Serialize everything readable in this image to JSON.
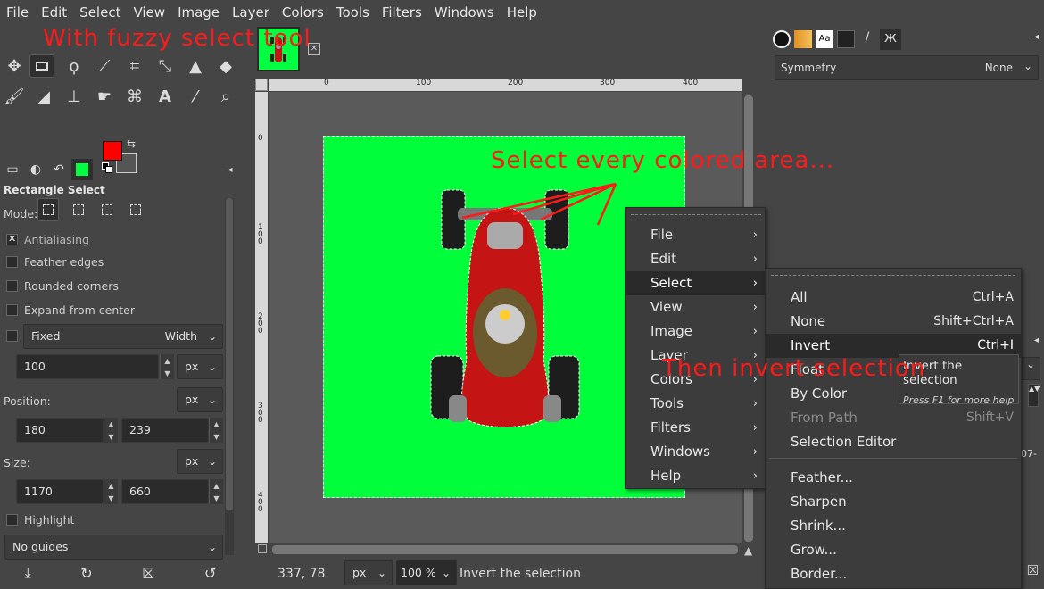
{
  "menubar": [
    "File",
    "Edit",
    "Select",
    "View",
    "Image",
    "Layer",
    "Colors",
    "Tools",
    "Filters",
    "Windows",
    "Help"
  ],
  "toolbox": {
    "tool_icons": [
      "move-tool-icon",
      "rectangle-select-icon",
      "lasso-icon",
      "fuzzy-select-icon",
      "crop-icon",
      "transform-icon",
      "warp-icon",
      "bucket-fill-icon",
      "paintbrush-icon",
      "eraser-icon",
      "clone-icon",
      "smudge-icon",
      "paths-icon",
      "text-icon",
      "color-picker-icon",
      "zoom-icon"
    ],
    "fg_color": "#ff0000",
    "bg_color": "#555555"
  },
  "tool_options": {
    "title": "Rectangle Select",
    "mode_label": "Mode:",
    "antialiasing": "Antialiasing",
    "feather_edges": "Feather edges",
    "rounded_corners": "Rounded corners",
    "expand_from_center": "Expand from center",
    "fixed": "Fixed",
    "fixed_mode": "Width",
    "fixed_value": "100",
    "fixed_unit": "px",
    "position_label": "Position:",
    "position_unit": "px",
    "pos_x": "180",
    "pos_y": "239",
    "size_label": "Size:",
    "size_unit": "px",
    "size_w": "1170",
    "size_h": "660",
    "highlight": "Highlight",
    "guides": "No guides"
  },
  "rulers": {
    "top": [
      "0",
      "100",
      "200",
      "300",
      "400"
    ],
    "left": [
      "0",
      "1 0 0",
      "2 0 0",
      "3 0 0",
      "4 0 0"
    ]
  },
  "statusbar": {
    "coords": "337, 78",
    "unit": "px",
    "zoom": "100 %",
    "message": "Invert the selection"
  },
  "right_dock": {
    "symmetry_label": "Symmetry",
    "symmetry_value": "None"
  },
  "context_menu": {
    "items": [
      "File",
      "Edit",
      "Select",
      "View",
      "Image",
      "Layer",
      "Colors",
      "Tools",
      "Filters",
      "Windows",
      "Help"
    ],
    "selected": "Select"
  },
  "select_submenu": {
    "items": [
      {
        "label": "All",
        "shortcut": "Ctrl+A"
      },
      {
        "label": "None",
        "shortcut": "Shift+Ctrl+A"
      },
      {
        "label": "Invert",
        "shortcut": "Ctrl+I"
      },
      {
        "label": "Float",
        "shortcut": ""
      },
      {
        "label": "By Color",
        "shortcut": ""
      },
      {
        "label": "From Path",
        "shortcut": "Shift+V"
      },
      {
        "label": "Selection Editor",
        "shortcut": ""
      },
      {
        "label": "Feather...",
        "shortcut": ""
      },
      {
        "label": "Sharpen",
        "shortcut": ""
      },
      {
        "label": "Shrink...",
        "shortcut": ""
      },
      {
        "label": "Grow...",
        "shortcut": ""
      },
      {
        "label": "Border...",
        "shortcut": ""
      }
    ]
  },
  "tooltip": {
    "title": "Invert the selection",
    "help": "Press F1 for more help"
  },
  "annotations": {
    "a1": "With fuzzy select tool",
    "a2": "Select every colored area...",
    "a3": "Then invert selection"
  }
}
